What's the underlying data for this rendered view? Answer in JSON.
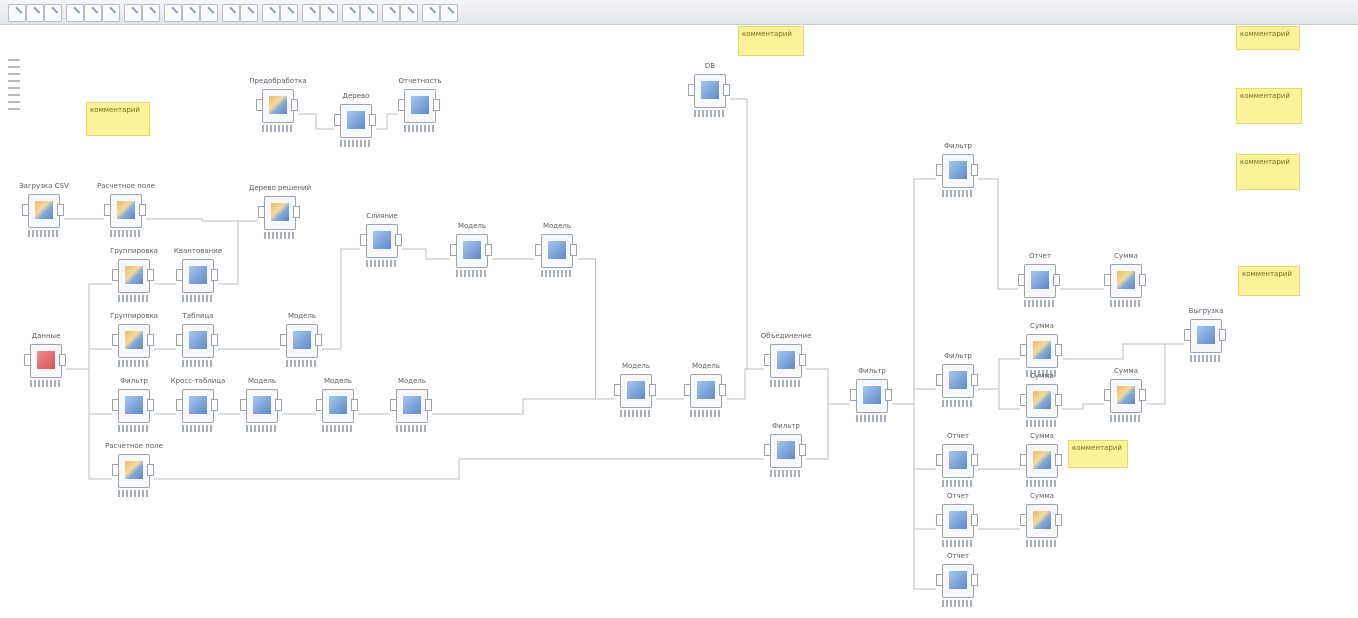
{
  "toolbar": {
    "buttons": [
      "toolbar-btn",
      "toolbar-btn",
      "toolbar-btn",
      "toolbar-btn",
      "toolbar-btn",
      "toolbar-btn",
      "toolbar-btn",
      "toolbar-btn",
      "toolbar-btn",
      "toolbar-btn",
      "toolbar-btn",
      "toolbar-btn",
      "toolbar-btn",
      "toolbar-btn",
      "toolbar-btn",
      "toolbar-btn",
      "toolbar-btn",
      "toolbar-btn",
      "toolbar-btn",
      "toolbar-btn",
      "toolbar-btn",
      "toolbar-btn",
      "toolbar-btn"
    ]
  },
  "nodes": [
    {
      "id": "n_src1",
      "label": "Загрузка CSV",
      "kind": "orange"
    },
    {
      "id": "n_calc1",
      "label": "Расчетное поле",
      "kind": "orange"
    },
    {
      "id": "n_pre1",
      "label": "Предобработка",
      "kind": "orange"
    },
    {
      "id": "n_d1",
      "label": "Дерево",
      "kind": "blue"
    },
    {
      "id": "n_rep1",
      "label": "Отчетность",
      "kind": "blue"
    },
    {
      "id": "n_dec1",
      "label": "Дерево решений",
      "kind": "orange"
    },
    {
      "id": "n_join",
      "label": "Слияние",
      "kind": "blue"
    },
    {
      "id": "n_main",
      "label": "Данные",
      "kind": "red"
    },
    {
      "id": "n_gr1",
      "label": "Группировка",
      "kind": "orange"
    },
    {
      "id": "n_gr2",
      "label": "Группировка",
      "kind": "orange"
    },
    {
      "id": "n_filt1",
      "label": "Фильтр",
      "kind": "blue"
    },
    {
      "id": "n_calc2",
      "label": "Расчетное поле",
      "kind": "orange"
    },
    {
      "id": "n_q1",
      "label": "Квантование",
      "kind": "blue"
    },
    {
      "id": "n_tab1",
      "label": "Таблица",
      "kind": "blue"
    },
    {
      "id": "n_cv1",
      "label": "Кросс-таблица",
      "kind": "blue"
    },
    {
      "id": "n_m1",
      "label": "Модель",
      "kind": "blue"
    },
    {
      "id": "n_m2",
      "label": "Модель",
      "kind": "blue"
    },
    {
      "id": "n_m3",
      "label": "Модель",
      "kind": "blue"
    },
    {
      "id": "n_m4",
      "label": "Модель",
      "kind": "blue"
    },
    {
      "id": "n_m5",
      "label": "Модель",
      "kind": "blue"
    },
    {
      "id": "n_m6",
      "label": "Модель",
      "kind": "blue"
    },
    {
      "id": "n_m7",
      "label": "Модель",
      "kind": "blue"
    },
    {
      "id": "n_m8",
      "label": "Модель",
      "kind": "blue"
    },
    {
      "id": "n_c1",
      "label": "Объединение",
      "kind": "blue"
    },
    {
      "id": "n_c2",
      "label": "Фильтр",
      "kind": "blue"
    },
    {
      "id": "n_c3",
      "label": "Фильтр",
      "kind": "blue"
    },
    {
      "id": "n_c4",
      "label": "Фильтр",
      "kind": "blue"
    },
    {
      "id": "n_c5",
      "label": "Фильтр",
      "kind": "blue"
    },
    {
      "id": "n_r1",
      "label": "Отчет",
      "kind": "blue"
    },
    {
      "id": "n_r2",
      "label": "Отчет",
      "kind": "blue"
    },
    {
      "id": "n_r3",
      "label": "Отчет",
      "kind": "blue"
    },
    {
      "id": "n_r4",
      "label": "Отчет",
      "kind": "blue"
    },
    {
      "id": "n_s1",
      "label": "Сумма",
      "kind": "orange"
    },
    {
      "id": "n_s2",
      "label": "Сумма",
      "kind": "orange"
    },
    {
      "id": "n_s3",
      "label": "Сумма",
      "kind": "orange"
    },
    {
      "id": "n_s4",
      "label": "Сумма",
      "kind": "orange"
    },
    {
      "id": "n_s5",
      "label": "Сумма",
      "kind": "orange"
    },
    {
      "id": "n_s6",
      "label": "Сумма",
      "kind": "orange"
    },
    {
      "id": "n_out1",
      "label": "Выгрузка",
      "kind": "blue"
    },
    {
      "id": "n_top",
      "label": "DB",
      "kind": "blue"
    }
  ],
  "notes": [
    {
      "id": "note1",
      "text": "комментарий"
    },
    {
      "id": "note2",
      "text": "комментарий"
    },
    {
      "id": "note3",
      "text": "комментарий"
    },
    {
      "id": "note4",
      "text": "комментарий"
    },
    {
      "id": "note5",
      "text": "комментарий"
    },
    {
      "id": "note6",
      "text": "комментарий"
    },
    {
      "id": "note7",
      "text": "комментарий"
    }
  ],
  "colors": {
    "edge": "#b7bfca",
    "accent_orange": "#e8a33b",
    "accent_blue": "#2b64b8",
    "note": "#faf39a"
  }
}
